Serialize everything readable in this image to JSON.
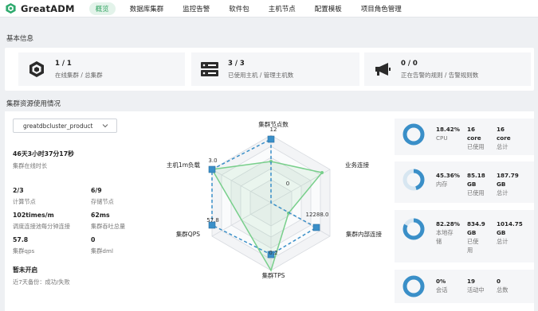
{
  "app": {
    "title": "GreatADM"
  },
  "nav": {
    "items": [
      {
        "label": "概览"
      },
      {
        "label": "数据库集群"
      },
      {
        "label": "监控告警"
      },
      {
        "label": "软件包"
      },
      {
        "label": "主机节点"
      },
      {
        "label": "配置模板"
      },
      {
        "label": "项目角色管理"
      }
    ]
  },
  "basic": {
    "title": "基本信息",
    "cards": [
      {
        "icon": "cube-icon",
        "value": "1 / 1",
        "label": "在线集群 / 总集群"
      },
      {
        "icon": "server-icon",
        "value": "3 / 3",
        "label": "已使用主机 / 管理主机数"
      },
      {
        "icon": "megaphone-icon",
        "value": "0 / 0",
        "label": "正在告警的规则 / 告警规则数"
      }
    ]
  },
  "usage": {
    "title": "集群资源使用情况",
    "cluster_select": "greatdbcluster_product",
    "uptime": {
      "value": "46天3小时37分17秒",
      "label": "集群在线时长"
    },
    "metrics": [
      {
        "value": "2/3",
        "label": "计算节点"
      },
      {
        "value": "6/9",
        "label": "存储节点"
      },
      {
        "value": "102times/m",
        "label": "调度连接池每分钟连接"
      },
      {
        "value": "62ms",
        "label": "集群吞吐总量"
      },
      {
        "value": "57.8",
        "label": "集群qps"
      },
      {
        "value": "0",
        "label": "集群dml"
      }
    ],
    "backup": {
      "value": "暂未开启",
      "label": "近7天备份：成功/失败"
    }
  },
  "radar": {
    "axes": [
      "集群节点数",
      "业务连接",
      "集群内部连接",
      "集群TPS",
      "集群QPS",
      "主机1m负载"
    ],
    "values": [
      "12",
      "0",
      "12288.0",
      "0.2",
      "57.8",
      "3.0"
    ],
    "colors": {
      "current": "#3a8fc8",
      "baseline": "#78cf8b"
    }
  },
  "resources": [
    {
      "percent": "18.42%",
      "percent_label": "CPU",
      "used_value": "16",
      "used_unit": "core",
      "used_label": "已使用",
      "total_value": "16",
      "total_unit": "core",
      "total_label": "总计",
      "ratio": 0.1842
    },
    {
      "percent": "45.36%",
      "percent_label": "内存",
      "used_value": "85.18",
      "used_unit": "GB",
      "used_label": "已使用",
      "total_value": "187.79",
      "total_unit": "GB",
      "total_label": "总计",
      "ratio": 0.4536
    },
    {
      "percent": "82.28%",
      "percent_label_1": "本地存",
      "percent_label_2": "储",
      "used_value": "834.9",
      "used_unit": "GB",
      "used_label_1": "已使",
      "used_label_2": "用",
      "total_value": "1014.75",
      "total_unit": "GB",
      "total_label": "总计",
      "ratio": 0.8228
    },
    {
      "percent": "0%",
      "percent_label": "会话",
      "used_value": "19",
      "used_label": "活动中",
      "total_value": "0",
      "total_label": "总数",
      "ratio": 0
    }
  ],
  "colors": {
    "accent": "#37a766",
    "ring": "#3a8fc8",
    "ring_track": "#d7e6f1"
  }
}
